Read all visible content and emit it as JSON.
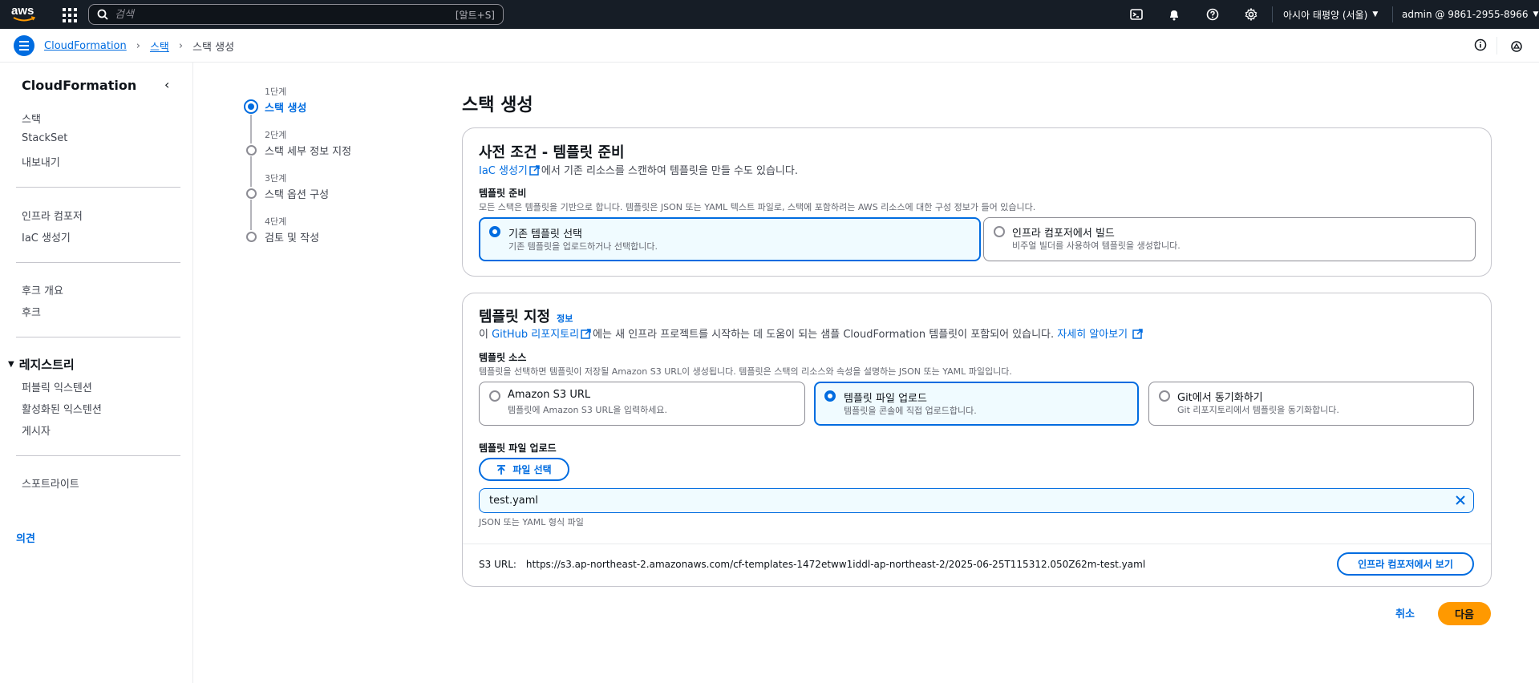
{
  "topnav": {
    "logo_text": "aws",
    "search_placeholder": "검색",
    "search_shortcut": "[알트+S]",
    "region": "아시아 태평양 (서울)",
    "account": "admin @ 9861-2955-8966"
  },
  "breadcrumb": {
    "items": [
      "CloudFormation",
      "스택",
      "스택 생성"
    ]
  },
  "sidebar": {
    "title": "CloudFormation",
    "items_group1": [
      "스택",
      "StackSet",
      "내보내기"
    ],
    "items_group2": [
      "인프라 컴포저",
      "IaC 생성기"
    ],
    "items_group3": [
      "후크 개요",
      "후크"
    ],
    "registry_title": "레지스트리",
    "items_registry": [
      "퍼블릭 익스텐션",
      "활성화된 익스텐션",
      "게시자"
    ],
    "items_group5": [
      "스포트라이트"
    ],
    "feedback": "의견"
  },
  "steps": [
    {
      "num": "1단계",
      "label": "스택 생성"
    },
    {
      "num": "2단계",
      "label": "스택 세부 정보 지정"
    },
    {
      "num": "3단계",
      "label": "스택 옵션 구성"
    },
    {
      "num": "4단계",
      "label": "검토 및 작성"
    }
  ],
  "page_title": "스택 생성",
  "prereq": {
    "title": "사전 조건 - 템플릿 준비",
    "desc_link": "IaC 생성기",
    "desc_rest": "에서 기존 리소스를 스캔하여 템플릿을 만들 수도 있습니다.",
    "label": "템플릿 준비",
    "hint": "모든 스택은 템플릿을 기반으로 합니다. 템플릿은 JSON 또는 YAML 텍스트 파일로, 스택에 포함하려는 AWS 리소스에 대한 구성 정보가 들어 있습니다.",
    "options": [
      {
        "title": "기존 템플릿 선택",
        "sub": "기존 템플릿을 업로드하거나 선택합니다."
      },
      {
        "title": "인프라 컴포저에서 빌드",
        "sub": "비주얼 빌더를 사용하여 템플릿을 생성합니다."
      }
    ]
  },
  "template": {
    "title": "템플릿 지정",
    "info": "정보",
    "desc_pre": "이 ",
    "desc_link": "GitHub 리포지토리",
    "desc_mid": "에는 새 인프라 프로젝트를 시작하는 데 도움이 되는 샘플 CloudFormation 템플릿이 포함되어 있습니다. ",
    "desc_link2": "자세히 알아보기",
    "source_label": "템플릿 소스",
    "source_hint": "템플릿을 선택하면 템플릿이 저장될 Amazon S3 URL이 생성됩니다. 템플릿은 스택의 리소스와 속성을 설명하는 JSON 또는 YAML 파일입니다.",
    "sources": [
      {
        "title": "Amazon S3 URL",
        "sub": "템플릿에 Amazon S3 URL을 입력하세요."
      },
      {
        "title": "템플릿 파일 업로드",
        "sub": "템플릿을 콘솔에 직접 업로드합니다."
      },
      {
        "title": "Git에서 동기화하기",
        "sub": "Git 리포지토리에서 템플릿을 동기화합니다."
      }
    ],
    "upload_label": "템플릿 파일 업로드",
    "file_button": "파일 선택",
    "file_name": "test.yaml",
    "file_hint": "JSON 또는 YAML 형식 파일",
    "s3_label": "S3 URL:",
    "s3_url": "https://s3.ap-northeast-2.amazonaws.com/cf-templates-1472etww1iddl-ap-northeast-2/2025-06-25T115312.050Z62m-test.yaml",
    "view_button": "인프라 컴포저에서 보기"
  },
  "actions": {
    "cancel": "취소",
    "next": "다음"
  },
  "colors": {
    "accent": "#006ce0",
    "nav_bg": "#161d26",
    "primary_button": "#ff9900"
  }
}
